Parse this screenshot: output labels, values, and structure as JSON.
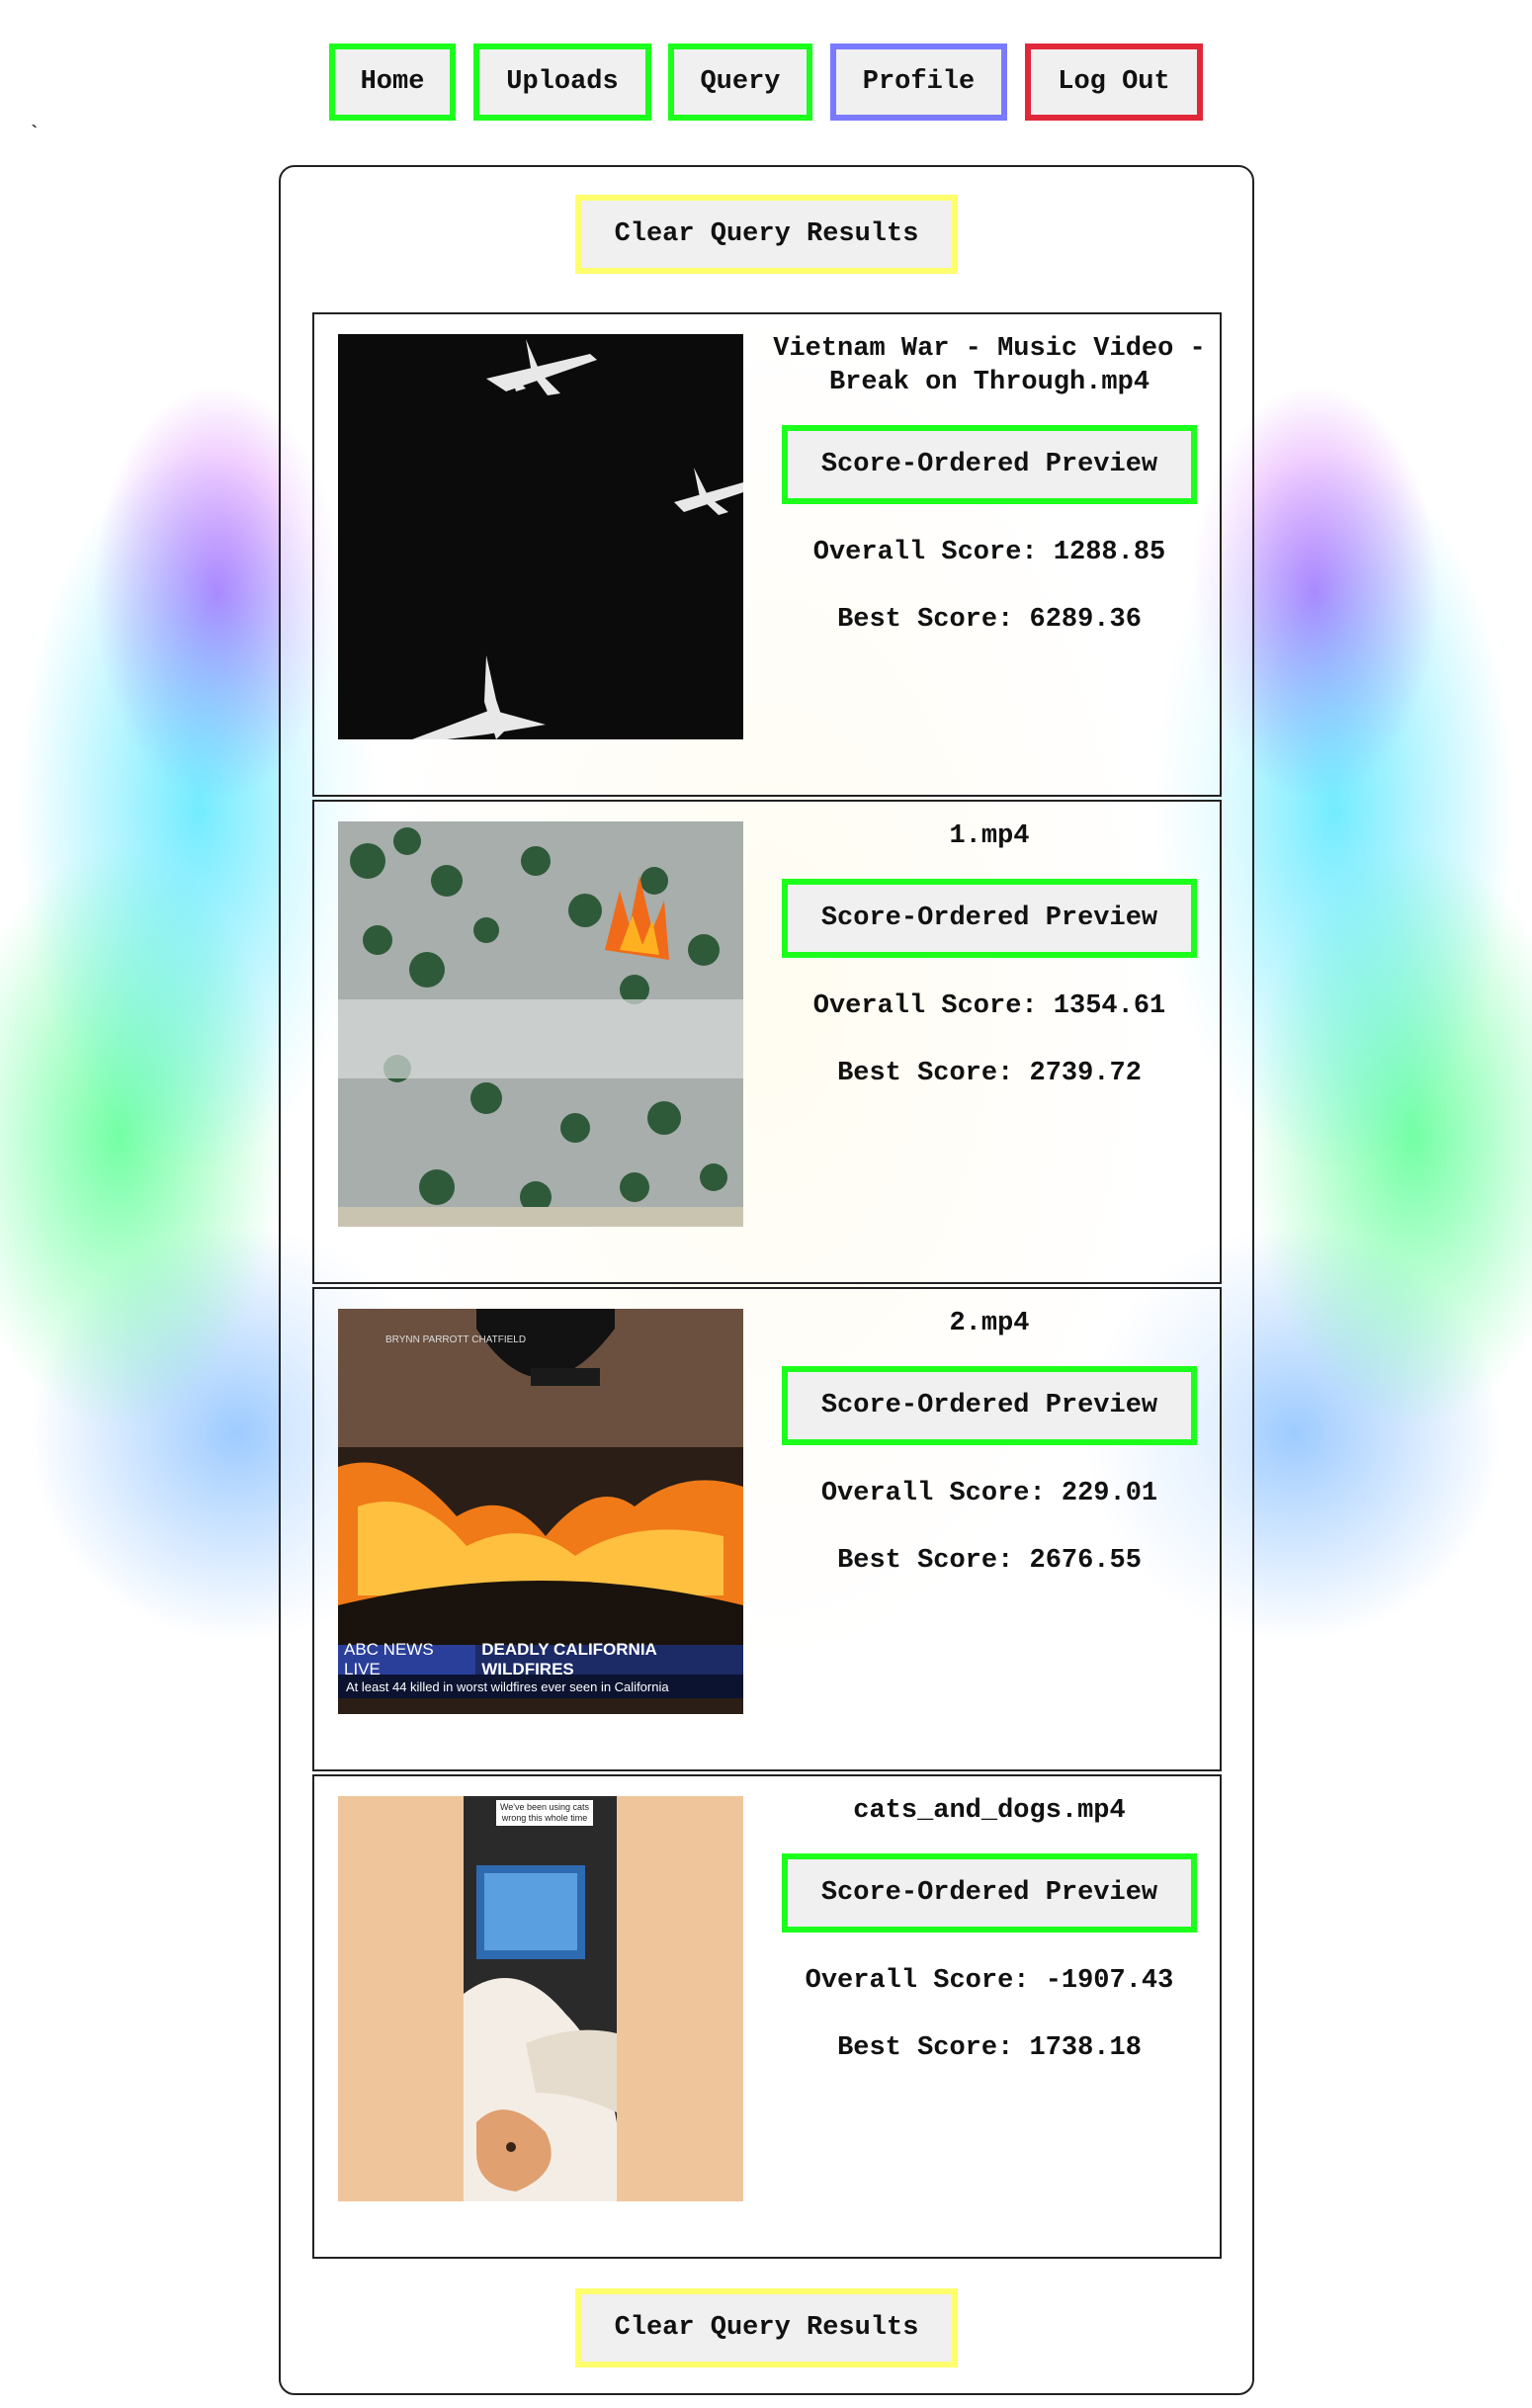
{
  "nav": {
    "items": [
      {
        "label": "Home",
        "color": "#1cff1c"
      },
      {
        "label": "Uploads",
        "color": "#1cff1c"
      },
      {
        "label": "Query",
        "color": "#1cff1c"
      },
      {
        "label": "Profile",
        "color": "#7a7aff"
      },
      {
        "label": "Log Out",
        "color": "#e0283a"
      }
    ]
  },
  "stray_char": "`",
  "panel": {
    "clear_label": "Clear Query Results",
    "results": [
      {
        "title": "Vietnam War - Music Video - Break on Through.mp4",
        "preview_label": "Score-Ordered Preview",
        "overall": "Overall Score: 1288.85",
        "best": "Best Score: 6289.36",
        "thumb": "planes-in-flight"
      },
      {
        "title": "1.mp4",
        "preview_label": "Score-Ordered Preview",
        "overall": "Overall Score: 1354.61",
        "best": "Best Score: 2739.72",
        "thumb": "forest-fire-aerial"
      },
      {
        "title": "2.mp4",
        "preview_label": "Score-Ordered Preview",
        "overall": "Overall Score: 229.01",
        "best": "Best Score: 2676.55",
        "thumb": "wildfire-through-windshield",
        "overlay": {
          "credit": "BRYNN PARROTT CHATFIELD",
          "tag": "ABC NEWS LIVE",
          "headline": "DEADLY CALIFORNIA WILDFIRES",
          "subline": "At least 44 killed in worst wildfires ever seen in California"
        }
      },
      {
        "title": "cats_and_dogs.mp4",
        "preview_label": "Score-Ordered Preview",
        "overall": "Overall Score: -1907.43",
        "best": "Best Score: 1738.18",
        "thumb": "cat-at-computer",
        "overlay": {
          "caption": "We've been using cats wrong this whole time"
        }
      }
    ]
  },
  "colors": {
    "green_border": "#1cff1c",
    "yellow_border": "#ffff6e",
    "blue_border": "#7a7aff",
    "red_border": "#e0283a"
  }
}
